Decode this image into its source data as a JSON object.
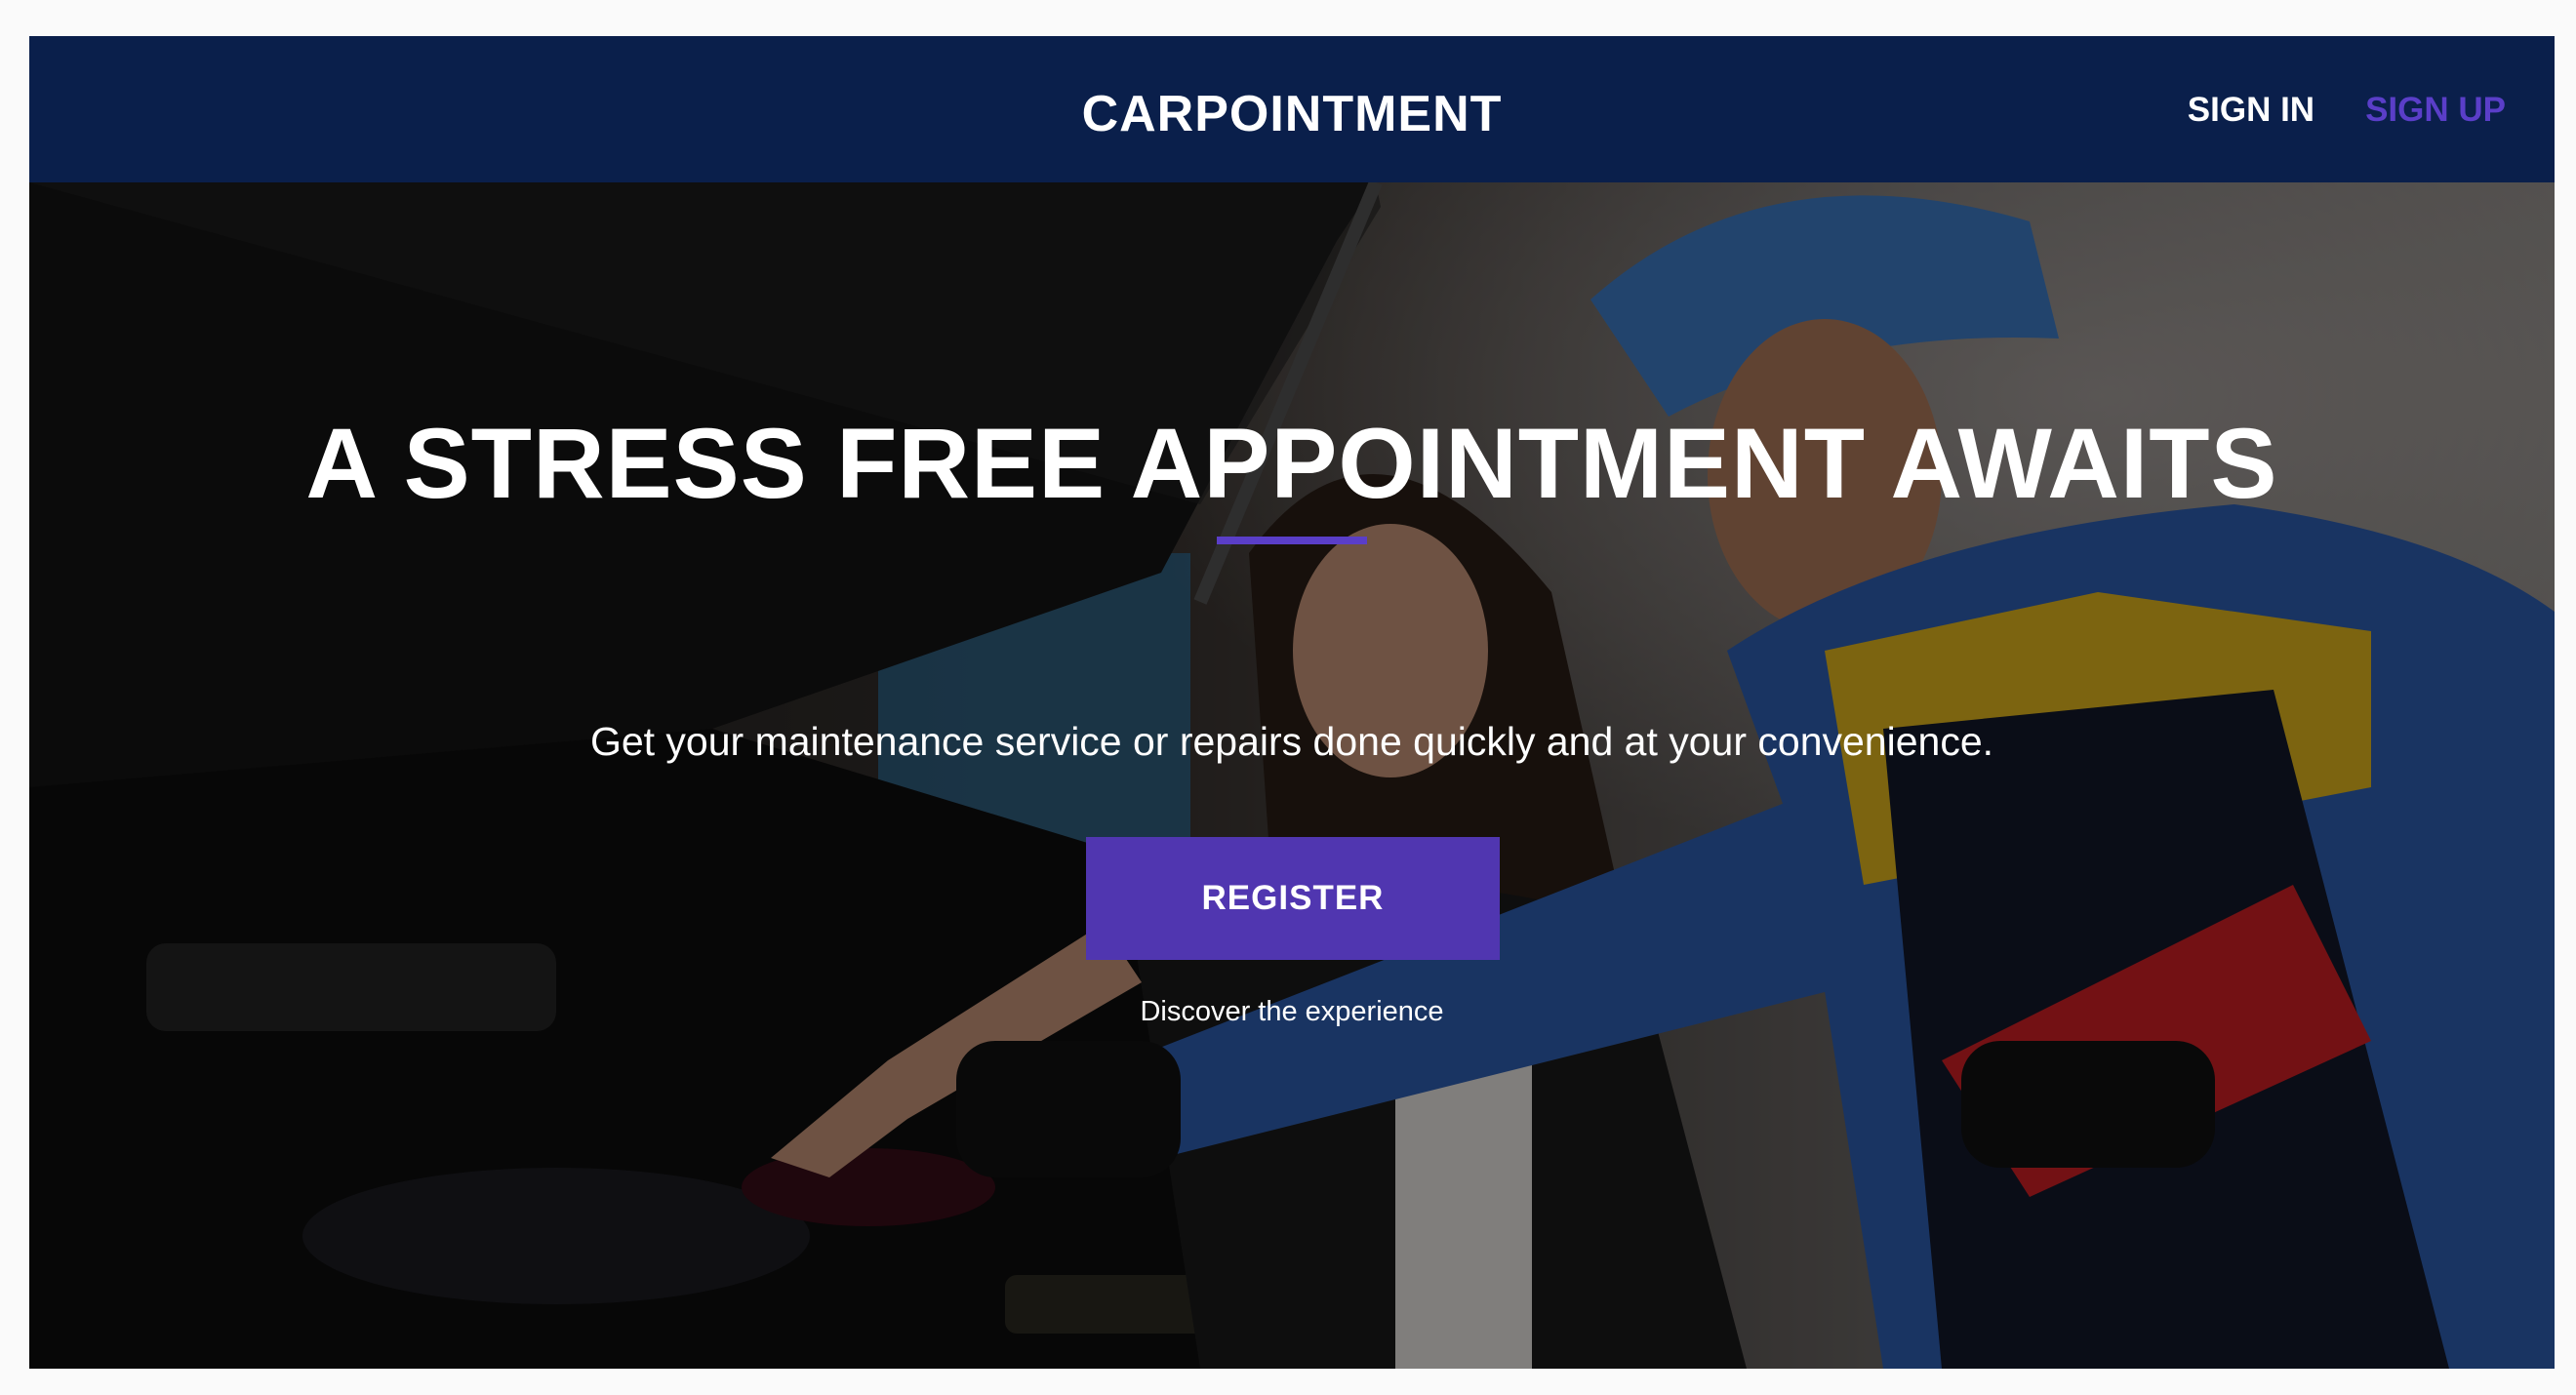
{
  "brand": {
    "name": "CARPOINTMENT"
  },
  "nav": {
    "sign_in": "SIGN IN",
    "sign_up": "SIGN UP"
  },
  "hero": {
    "headline": "A STRESS FREE APPOINTMENT AWAITS",
    "subtitle": "Get your maintenance service or repairs done quickly and at your convenience.",
    "cta_label": "REGISTER",
    "cta_caption": "Discover the experience",
    "background_image": "mechanic-and-customer-inspecting-car-engine"
  },
  "colors": {
    "navbar_bg": "#0a1f4b",
    "accent": "#5a3ec8",
    "button_bg": "#5036b0",
    "text_light": "#ffffff"
  }
}
